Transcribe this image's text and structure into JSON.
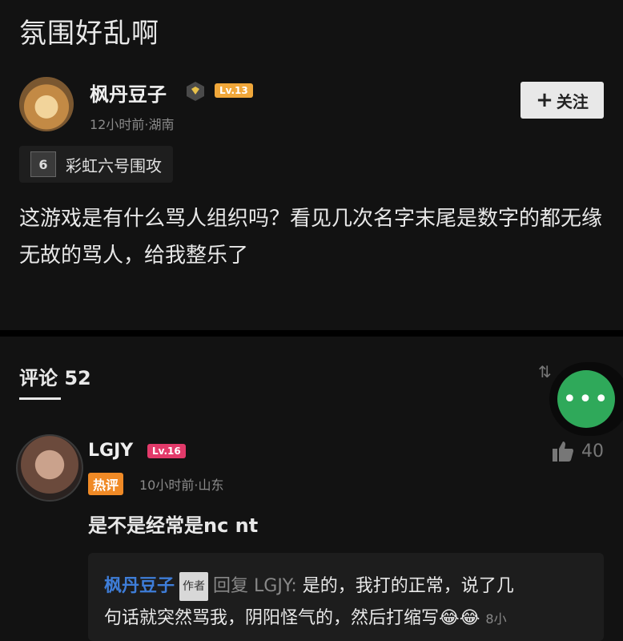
{
  "post": {
    "title": "氛围好乱啊",
    "author": {
      "name": "枫丹豆子",
      "level": "Lv.13",
      "meta": "12小时前·湖南"
    },
    "follow_label": "关注",
    "game_tag": "彩虹六号围攻",
    "body": "这游戏是有什么骂人组织吗？看见几次名字末尾是数字的都无缘无故的骂人，给我整乐了"
  },
  "comments": {
    "header": "评论 52",
    "items": [
      {
        "name": "LGJY",
        "level": "Lv.16",
        "hot_label": "热评",
        "meta": "10小时前·山东",
        "likes": "40",
        "text": "是不是经常是nc nt",
        "reply": {
          "author": "枫丹豆子",
          "author_tag": "作者",
          "reply_to": "回复 LGJY:",
          "line1": "是的，我打的正常，说了几",
          "line2": "句话就突然骂我，阴阳怪气的，然后打缩写😂😂",
          "time": "8小"
        }
      }
    ]
  },
  "colors": {
    "follow_bg": "#e8e8e8",
    "fab": "#2fa95a",
    "hot": "#f08a26",
    "lv_author": "#f0a73a",
    "lv_commenter": "#e23a6a",
    "reply_author": "#3e7dd8"
  }
}
